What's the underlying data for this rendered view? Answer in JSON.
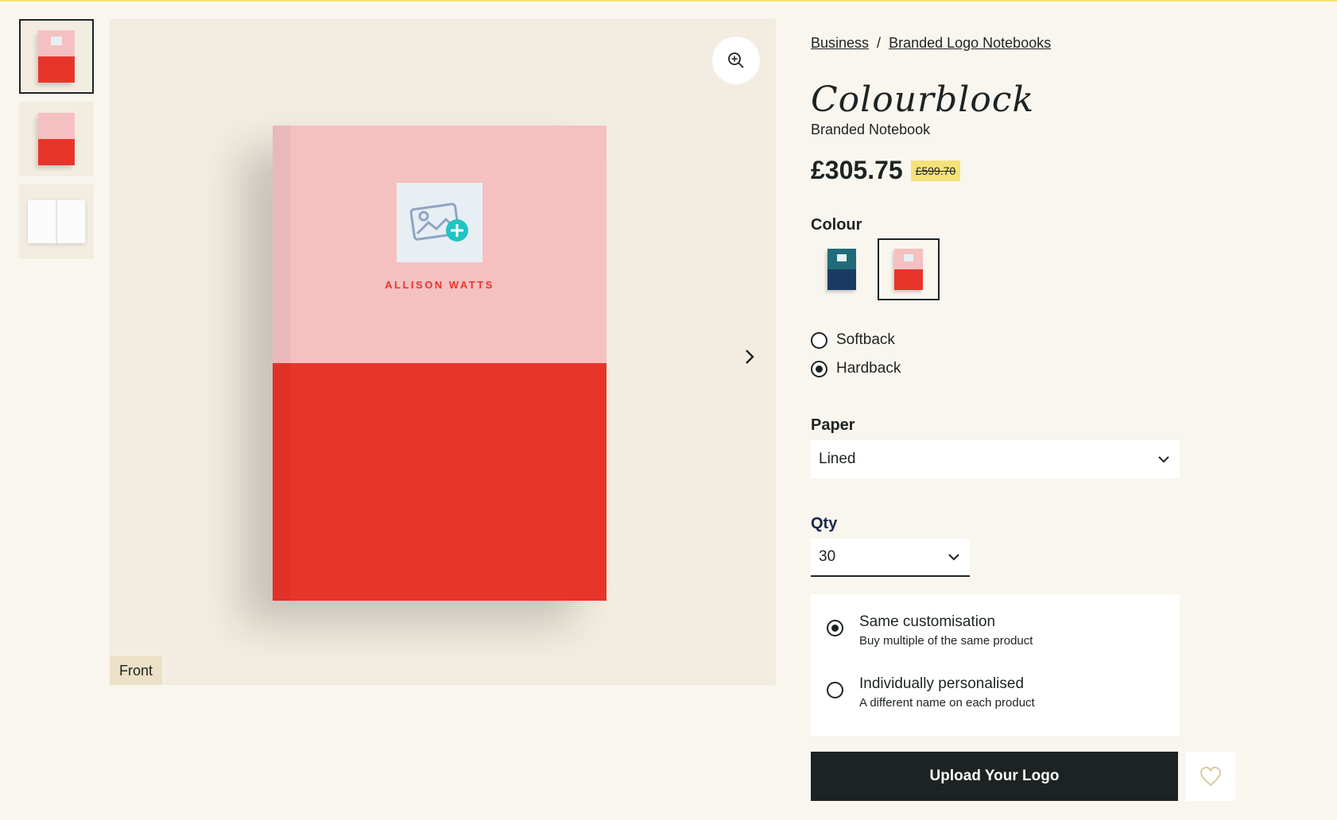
{
  "thumbnails": [
    {
      "name": "front",
      "active": true
    },
    {
      "name": "back",
      "active": false
    },
    {
      "name": "inside",
      "active": false
    }
  ],
  "main_image": {
    "personalised_name": "ALLISON WATTS",
    "view_label": "Front",
    "zoom_icon": "zoom-in-icon",
    "next_icon": "chevron-right-icon"
  },
  "breadcrumb": {
    "items": [
      "Business",
      "Branded Logo Notebooks"
    ],
    "separator": "/"
  },
  "product": {
    "title": "Colourblock",
    "subtitle": "Branded Notebook",
    "price": "£305.75",
    "old_price": "£599.70"
  },
  "colour": {
    "label": "Colour",
    "swatches": [
      {
        "top": "#1f6c78",
        "bottom": "#1a3a63",
        "active": false
      },
      {
        "top": "#f4c0c0",
        "bottom": "#e8352b",
        "active": true
      }
    ]
  },
  "cover": {
    "options": [
      {
        "label": "Softback",
        "checked": false
      },
      {
        "label": "Hardback",
        "checked": true
      }
    ]
  },
  "paper": {
    "label": "Paper",
    "selected": "Lined"
  },
  "qty": {
    "label": "Qty",
    "selected": "30"
  },
  "customisation": {
    "options": [
      {
        "title": "Same customisation",
        "desc": "Buy multiple of the same product",
        "checked": true
      },
      {
        "title": "Individually personalised",
        "desc": "A different name on each product",
        "checked": false
      }
    ]
  },
  "actions": {
    "upload_label": "Upload Your Logo",
    "wishlist_icon": "heart-icon"
  },
  "colors": {
    "background": "#f9f6ef",
    "dark": "#1d2323",
    "highlight": "#f5e27a",
    "pink": "#f4c0c0",
    "red": "#e8352b",
    "heart": "#d9c9a0"
  }
}
